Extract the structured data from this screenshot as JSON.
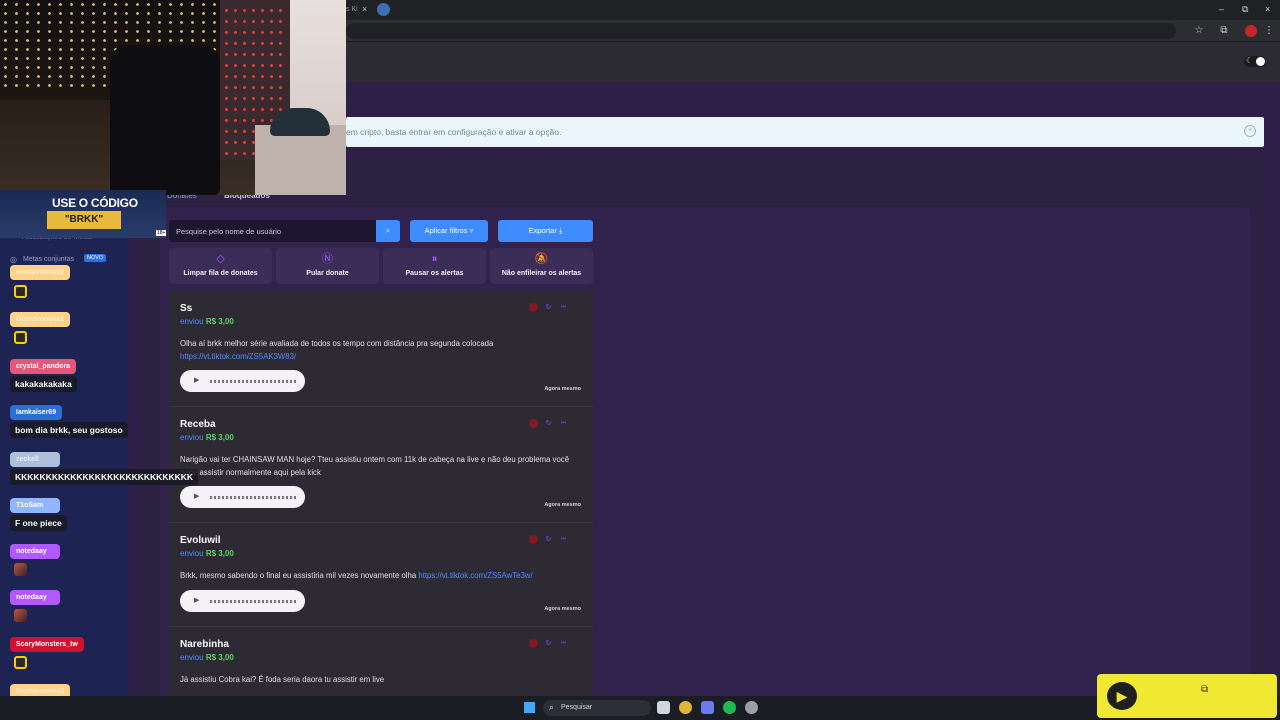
{
  "browser": {
    "tab_partial": "s Ki",
    "tab_close": "×",
    "win_min": "–",
    "win_max": "⧉",
    "win_close": "×"
  },
  "banner": {
    "text": "em cripto, basta entrar em configuração e ativar a opção.",
    "close": "×"
  },
  "tabs": {
    "donates": "Donates",
    "blocked": "Bloqueados"
  },
  "sidebar": {
    "faded_item": "Atualizações de Metas",
    "metas_label": "Metas conjuntas",
    "metas_badge": "NOVO"
  },
  "promo": {
    "line1": "USE O CÓDIGO",
    "code": "\"BRKK\"",
    "age": "18+"
  },
  "chat": [
    {
      "name": "Gustavonoka2",
      "color": "#ffd28a",
      "msg": "",
      "emote": "yellow"
    },
    {
      "name": "Gustavonoka2",
      "color": "#ffd28a",
      "msg": "",
      "emote": "yellow"
    },
    {
      "name": "crystal_pandora",
      "color": "#e8557a",
      "msg": "kakakakakaka"
    },
    {
      "name": "Iamkaiser69",
      "color": "#2a6fd6",
      "msg": "bom dia brkk, seu gostoso"
    },
    {
      "name": "zeckell",
      "color": "#b0bfd9",
      "msg": "KKKKKKKKKKKKKKKKKKKKKKKKKKKKK"
    },
    {
      "name": "T1oSam",
      "color": "#8fb6ff",
      "msg": "F one piece"
    },
    {
      "name": "notedaay",
      "color": "#b158ff",
      "msg": "",
      "emote": "pic"
    },
    {
      "name": "notedaay",
      "color": "#b158ff",
      "msg": "",
      "emote": "pic"
    },
    {
      "name": "ScaryMonsters_tw",
      "color": "#d0122e",
      "msg": "",
      "emote": "yellow"
    },
    {
      "name": "Gustavonoka2",
      "color": "#ffd28a",
      "msg": "",
      "emote": "pic"
    }
  ],
  "search": {
    "placeholder": "Pesquise pelo nome de usuário",
    "icon": "🔍"
  },
  "buttons": {
    "filter": "Aplicar filtros ▿",
    "export": "Exportar ⤓"
  },
  "actions": [
    {
      "label": "Limpar fila de donates",
      "icon": "◇"
    },
    {
      "label": "Pular donate",
      "icon": "Ⓝ"
    },
    {
      "label": "Pausar os alertas",
      "icon": "⏸"
    },
    {
      "label": "Não enfileirar os alertas",
      "icon": "🔕"
    }
  ],
  "donates": [
    {
      "name": "Ss",
      "sent": "enviou",
      "amount": "R$ 3,00",
      "msg": "Olha aí brkk melhor série avaliada de todos os tempo com distância pra segunda colocada",
      "link": "https://vt.tiktok.com/ZS5AK3W83/",
      "time": "Agora mesmo"
    },
    {
      "name": "Receba",
      "sent": "enviou",
      "amount": "R$ 3,00",
      "msg": "Narigão vai ter CHAINSAW MAN hoje? Tteu assistiu ontem com 11k de cabeça na live e não deu problema você pode assistir normalmente aqui pela kick",
      "link": "",
      "time": "Agora mesmo"
    },
    {
      "name": "Evoluwil",
      "sent": "enviou",
      "amount": "R$ 3,00",
      "msg": "Brkk, mesmo sabendo o final eu assistiria mil vezes novamente olha",
      "link": "https://vt.tiktok.com/ZS5AwTe3w/",
      "time": "Agora mesmo"
    },
    {
      "name": "Narebinha",
      "sent": "enviou",
      "amount": "R$ 3,00",
      "msg": "Já assistiu Cobra kai? É foda seria daora tu assistir em live",
      "link": "",
      "time": "Agora mesmo"
    }
  ],
  "taskbar": {
    "search": "Pesquisar"
  }
}
